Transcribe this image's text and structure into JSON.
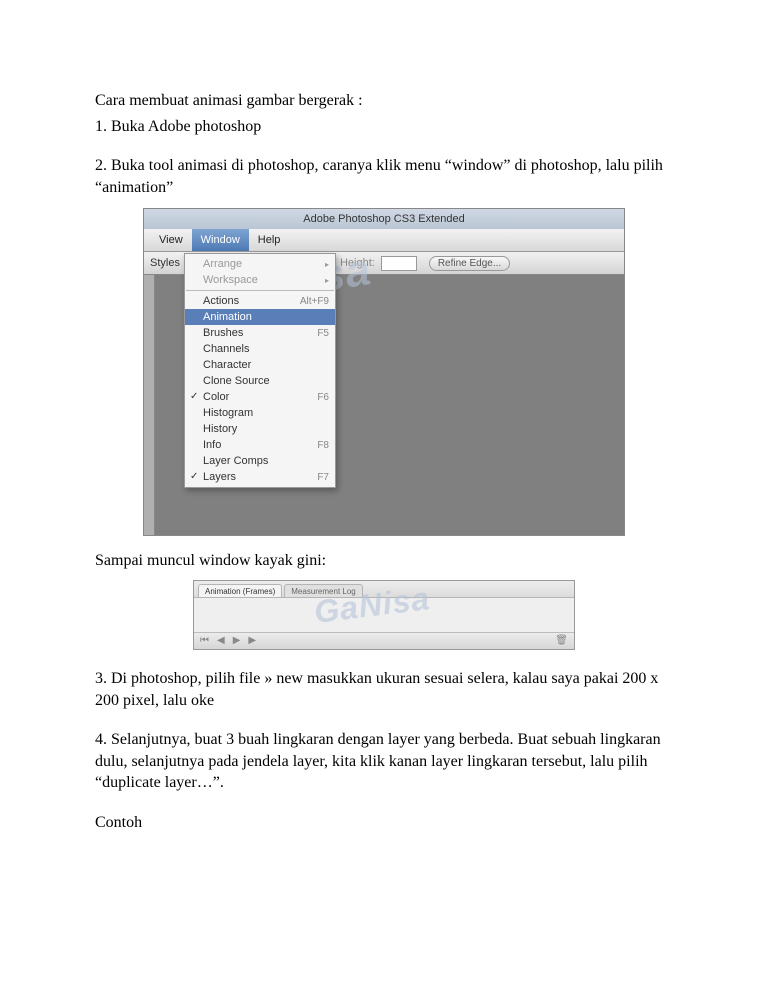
{
  "doc": {
    "p1": "Cara membuat animasi gambar bergerak :",
    "p2": "1. Buka Adobe photoshop",
    "p3": "2. Buka tool animasi di photoshop, caranya klik menu “window” di photoshop, lalu pilih “animation”",
    "p4": "Sampai muncul window kayak gini:",
    "p5": "3. Di photoshop, pilih file » new masukkan ukuran sesuai selera, kalau saya pakai 200 x 200 pixel, lalu oke",
    "p6": "4. Selanjutnya, buat 3 buah lingkaran dengan layer yang berbeda. Buat sebuah lingkaran dulu, selanjutnya pada jendela layer, kita klik kanan layer lingkaran tersebut, lalu pilih “duplicate layer…”.",
    "p7": "Contoh"
  },
  "shot1": {
    "title": "Adobe Photoshop CS3 Extended",
    "menu": {
      "view": "View",
      "window": "Window",
      "help": "Help"
    },
    "toolbar": {
      "styles": "Styles",
      "height": "Height:",
      "refine": "Refine Edge..."
    },
    "dropdown": {
      "arrange": "Arrange",
      "workspace": "Workspace",
      "actions": "Actions",
      "actions_sc": "Alt+F9",
      "animation": "Animation",
      "brushes": "Brushes",
      "brushes_sc": "F5",
      "channels": "Channels",
      "character": "Character",
      "clone": "Clone Source",
      "color": "Color",
      "color_sc": "F6",
      "histogram": "Histogram",
      "history": "History",
      "info": "Info",
      "info_sc": "F8",
      "layercomps": "Layer Comps",
      "layers": "Layers",
      "layers_sc": "F7"
    },
    "watermark": "GaNisa"
  },
  "shot2": {
    "tab1": "Animation (Frames)",
    "tab2": "Measurement Log",
    "watermark": "GaNisa"
  }
}
